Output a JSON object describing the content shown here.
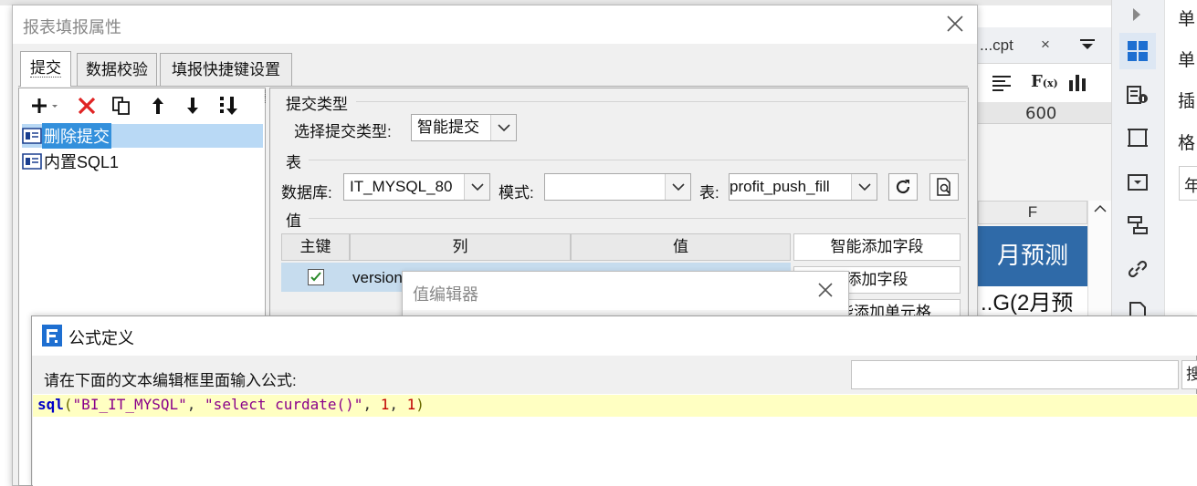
{
  "background": {
    "file_tab": {
      "label": "...cpt",
      "close": "×"
    },
    "ruler_mark": "600",
    "column_header": "F",
    "cell_1": "月预测",
    "cell_2": "..G(2月预",
    "right_panel_labels": [
      "单",
      "单",
      "插",
      "格",
      "年"
    ],
    "colors": {
      "cell_blue": "#2f6aa8",
      "sidebar_active": "#1e6fd1"
    }
  },
  "dialog_properties": {
    "title": "报表填报属性",
    "tabs": [
      "提交",
      "数据校验",
      "填报快捷键设置"
    ],
    "tree_items": [
      "删除提交",
      "内置SQL1"
    ],
    "submit_section": {
      "label": "提交类型",
      "select_label": "选择提交类型:",
      "select_value": "智能提交"
    },
    "table_section": {
      "label": "表",
      "db_label": "数据库:",
      "db_value": "IT_MYSQL_80",
      "schema_label": "模式:",
      "schema_value": "",
      "table_label": "表:",
      "table_value": "profit_push_fill"
    },
    "value_section": {
      "label": "值",
      "headers": [
        "主键",
        "列",
        "值"
      ],
      "rows": [
        {
          "key_checked": true,
          "column": "version"
        }
      ]
    },
    "side_buttons": [
      "智能添加字段",
      "添加字段",
      "智能添加单元格"
    ]
  },
  "dialog_value_editor": {
    "title": "值编辑器"
  },
  "dialog_formula": {
    "title": "公式定义",
    "prompt": "请在下面的文本编辑框里面输入公式:",
    "search_value": "",
    "button_peek": "搜",
    "formula_parts": {
      "fn": "sql",
      "open": "(",
      "arg1": "\"BI_IT_MYSQL\"",
      "sep1": ", ",
      "arg2": "\"select curdate()\"",
      "sep2": ", ",
      "arg3": "1",
      "sep3": ", ",
      "arg4": "1",
      "close": ")"
    }
  }
}
